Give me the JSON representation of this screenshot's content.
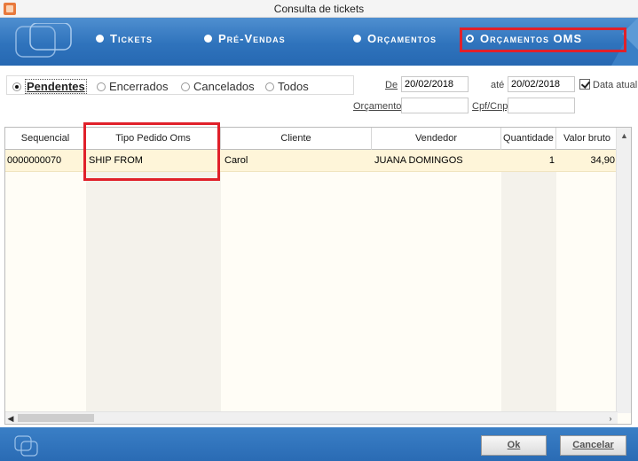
{
  "window": {
    "title": "Consulta de tickets"
  },
  "header": {
    "options": [
      {
        "label": "Tickets",
        "selected": false
      },
      {
        "label": "Pré-Vendas",
        "selected": false
      },
      {
        "label": "Orçamentos",
        "selected": false
      },
      {
        "label": "Orçamentos OMS",
        "selected": true
      }
    ]
  },
  "filters": {
    "status": [
      {
        "label": "Pendentes",
        "checked": true
      },
      {
        "label": "Encerrados",
        "checked": false
      },
      {
        "label": "Cancelados",
        "checked": false
      },
      {
        "label": "Todos",
        "checked": false
      }
    ],
    "de_label": "De",
    "de_value": "20/02/2018",
    "ate_label": "até",
    "ate_value": "20/02/2018",
    "data_atual_label": "Data atual",
    "data_atual_checked": true,
    "orcamento_label": "Orçamento",
    "orcamento_value": "",
    "cpf_label": "Cpf/Cnpj",
    "cpf_value": ""
  },
  "grid": {
    "columns": [
      "Sequencial",
      "Tipo Pedido Oms",
      "Cliente",
      "Vendedor",
      "Quantidade",
      "Valor bruto"
    ],
    "rows": [
      {
        "sequencial": "0000000070",
        "tipo": "SHIP FROM",
        "cliente": "Carol",
        "vendedor": "JUANA DOMINGOS",
        "quantidade": "1",
        "valor": "34,90"
      }
    ]
  },
  "footer": {
    "ok_label": "Ok",
    "cancel_label": "Cancelar"
  },
  "colors": {
    "header_blue": "#2f73bc",
    "highlight_red": "#e0202a",
    "row_selected": "#fef5d9"
  }
}
